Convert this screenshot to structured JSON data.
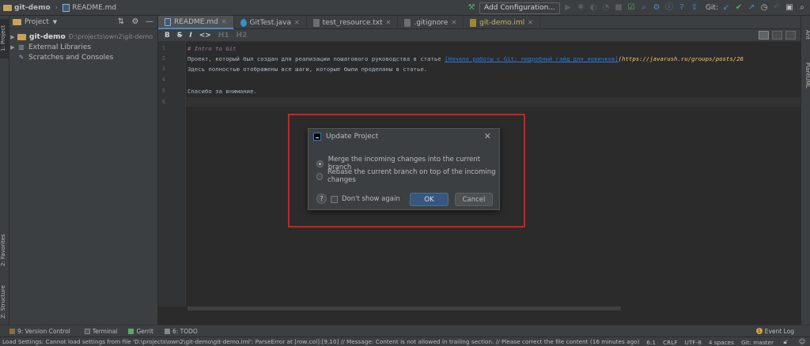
{
  "titlebar": {
    "project_name": "git-demo",
    "file_name": "README.md",
    "add_config_label": "Add Configuration...",
    "git_label": "Git:"
  },
  "left_strip": {
    "project_label": "1: Project",
    "favorites_label": "2: Favorites",
    "structure_label": "Z: Structure"
  },
  "right_strip": {
    "ant_label": "Ant",
    "plantuml_label": "PlantUML"
  },
  "project_panel": {
    "header": "Project",
    "tree": [
      {
        "label": "git-demo",
        "path": "D:\\projects\\own2\\git-demo"
      },
      {
        "label": "External Libraries",
        "path": ""
      },
      {
        "label": "Scratches and Consoles",
        "path": ""
      }
    ]
  },
  "tabs": [
    {
      "label": "README.md"
    },
    {
      "label": "GitTest.java"
    },
    {
      "label": "test_resource.txt"
    },
    {
      "label": ".gitignore"
    },
    {
      "label": "git-demo.iml"
    }
  ],
  "md_toolbar": {
    "bold": "B",
    "strike": "S",
    "italic": "I",
    "code": "<>",
    "h1": "H1",
    "h2": "H2"
  },
  "editor": {
    "line_numbers": [
      "1",
      "2",
      "3",
      "4",
      "5",
      "6"
    ],
    "line1": "# Intro to Git",
    "line2_text": "Проект, который был создан для реализации пошагового руководства в статье ",
    "line2_link": "[Начало работы с Git: подробный гайд для новичков]",
    "line2_url": "(https://javarush.ru/groups/posts/26",
    "line3": "Здесь полностью отображены все шаги, которые были проделаны в статье.",
    "line5": "Спасибо за внимание."
  },
  "dialog": {
    "title": "Update Project",
    "option_merge": "Merge the incoming changes into the current branch",
    "option_rebase": "Rebase the current branch on top of the incoming changes",
    "dont_show": "Don't show again",
    "ok": "OK",
    "cancel": "Cancel",
    "help": "?"
  },
  "bottom_tabs": {
    "version_control": "9: Version Control",
    "terminal": "Terminal",
    "gerrit": "Gerrit",
    "todo": "6: TODO",
    "event_log": "Event Log",
    "event_log_count": "1"
  },
  "status": {
    "message": "Load Settings: Cannot load settings from file 'D:\\projects\\own2\\git-demo\\git-demo.iml': ParseError at [row,col]:[9,10] // Message: Content is not allowed in trailing section. // Please correct the file content (16 minutes ago)",
    "position": "6:1",
    "line_sep": "CRLF",
    "encoding": "UTF-8",
    "indent": "4 spaces",
    "branch": "Git: master"
  },
  "colors": {
    "accent": "#4a88c7",
    "highlight_border": "#cc2222",
    "ok_button": "#365880"
  }
}
